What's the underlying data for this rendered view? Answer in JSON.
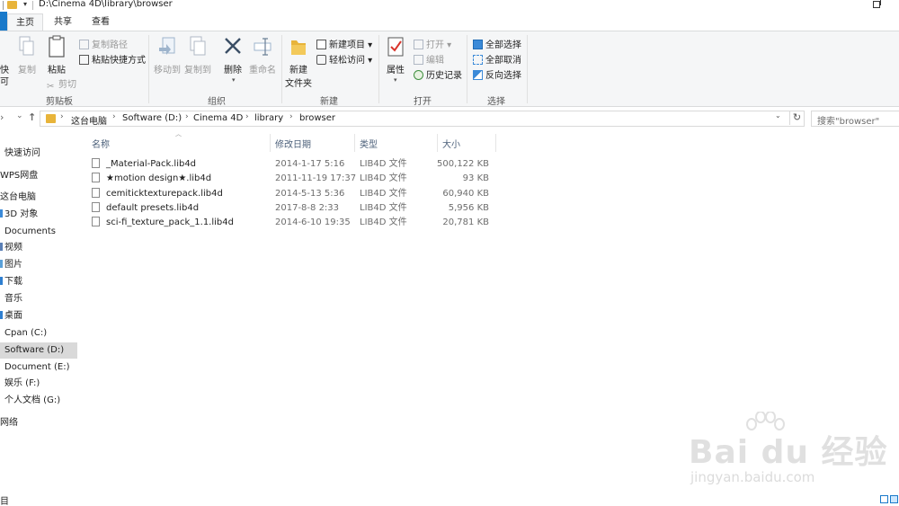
{
  "window": {
    "title": "D:\\Cinema 4D\\library\\browser"
  },
  "tabs": [
    {
      "label": "主页",
      "active": true
    },
    {
      "label": "共享",
      "active": false
    },
    {
      "label": "查看",
      "active": false
    }
  ],
  "ribbon": {
    "clipboard": {
      "pin_label": "快",
      "pin_label2": "可",
      "copy": "复制",
      "paste": "粘贴",
      "copy_path": "复制路径",
      "paste_shortcut": "粘贴快捷方式",
      "cut": "剪切",
      "group": "剪贴板"
    },
    "organize": {
      "move_to": "移动到",
      "copy_to": "复制到",
      "delete": "删除",
      "rename": "重命名",
      "group": "组织"
    },
    "new": {
      "new_folder_line1": "新建",
      "new_folder_line2": "文件夹",
      "new_item": "新建项目",
      "easy_access": "轻松访问",
      "group": "新建"
    },
    "open": {
      "properties": "属性",
      "open": "打开",
      "edit": "编辑",
      "history": "历史记录",
      "group": "打开"
    },
    "select": {
      "select_all": "全部选择",
      "select_none": "全部取消",
      "invert": "反向选择",
      "group": "选择"
    }
  },
  "address": {
    "crumbs": [
      "这台电脑",
      "Software (D:)",
      "Cinema 4D",
      "library",
      "browser"
    ],
    "search_placeholder": "搜索\"browser\""
  },
  "nav": [
    {
      "label": "快速访问",
      "icon_color": "#1979ca",
      "selected": false
    },
    {
      "label": "WPS网盘",
      "icon_color": "#1979ca",
      "selected": false
    },
    {
      "label": "这台电脑",
      "icon_color": "#1979ca",
      "selected": false
    },
    {
      "label": "3D 对象",
      "icon_color": "#3b8ad8",
      "selected": false
    },
    {
      "label": "Documents",
      "icon_color": "#8a8a8a",
      "selected": false
    },
    {
      "label": "视频",
      "icon_color": "#5a7fb5",
      "selected": false
    },
    {
      "label": "图片",
      "icon_color": "#5aa0d8",
      "selected": false
    },
    {
      "label": "下载",
      "icon_color": "#2f7fd0",
      "selected": false
    },
    {
      "label": "音乐",
      "icon_color": "#4a8fd6",
      "selected": false
    },
    {
      "label": "桌面",
      "icon_color": "#2f7fd0",
      "selected": false
    },
    {
      "label": "Cpan (C:)",
      "icon_color": "#8a8a8a",
      "selected": false
    },
    {
      "label": "Software (D:)",
      "icon_color": "#8a8a8a",
      "selected": true
    },
    {
      "label": "Document (E:)",
      "icon_color": "#8a8a8a",
      "selected": false
    },
    {
      "label": "娱乐 (F:)",
      "icon_color": "#8a8a8a",
      "selected": false
    },
    {
      "label": "个人文档 (G:)",
      "icon_color": "#8a8a8a",
      "selected": false
    },
    {
      "label": "网络",
      "icon_color": "#1979ca",
      "selected": false
    }
  ],
  "columns": [
    "名称",
    "修改日期",
    "类型",
    "大小"
  ],
  "files": [
    {
      "name": "_Material-Pack.lib4d",
      "date": "2014-1-17 5:16",
      "type": "LIB4D 文件",
      "size": "500,122 KB"
    },
    {
      "name": "★motion design★.lib4d",
      "date": "2011-11-19 17:37",
      "type": "LIB4D 文件",
      "size": "93 KB"
    },
    {
      "name": "cemiticktexturepack.lib4d",
      "date": "2014-5-13 5:36",
      "type": "LIB4D 文件",
      "size": "60,940 KB"
    },
    {
      "name": "default presets.lib4d",
      "date": "2017-8-8 2:33",
      "type": "LIB4D 文件",
      "size": "5,956 KB"
    },
    {
      "name": "sci-fi_texture_pack_1.1.lib4d",
      "date": "2014-6-10 19:35",
      "type": "LIB4D 文件",
      "size": "20,781 KB"
    }
  ],
  "status": {
    "text": "目"
  },
  "watermark": {
    "logo": "Bai du 经验",
    "sub": "jingyan.baidu.com"
  },
  "colors": {
    "accent": "#1979ca",
    "folder": "#e8b43a",
    "selection": "#cce8ff"
  }
}
